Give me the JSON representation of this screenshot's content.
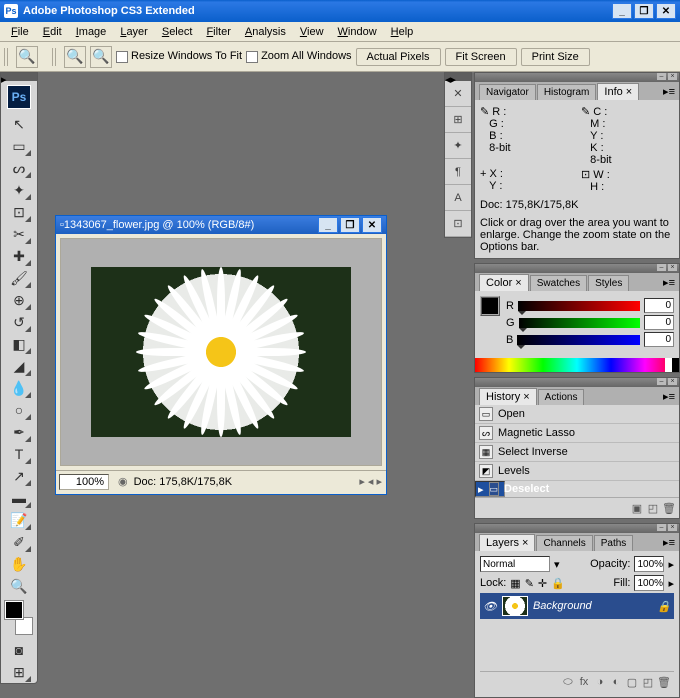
{
  "title": "Adobe Photoshop CS3 Extended",
  "menu": [
    "File",
    "Edit",
    "Image",
    "Layer",
    "Select",
    "Filter",
    "Analysis",
    "View",
    "Window",
    "Help"
  ],
  "options": {
    "resize": "Resize Windows To Fit",
    "zoomall": "Zoom All Windows",
    "actual": "Actual Pixels",
    "fit": "Fit Screen",
    "print": "Print Size"
  },
  "doc": {
    "title": "1343067_flower.jpg @ 100% (RGB/8#)",
    "zoom": "100%",
    "status": "Doc: 175,8K/175,8K"
  },
  "panels": {
    "nav": {
      "tabs": [
        "Navigator",
        "Histogram",
        "Info"
      ]
    },
    "info": {
      "r": "R :",
      "g": "G :",
      "b": "B :",
      "bit1": "8-bit",
      "c": "C :",
      "m": "M :",
      "y": "Y :",
      "k": "K :",
      "bit2": "8-bit",
      "x": "X :",
      "yv": "Y :",
      "w": "W :",
      "h": "H :",
      "doc": "Doc: 175,8K/175,8K",
      "hint": "Click or drag over the area you want to enlarge. Change the zoom state on the Options bar."
    },
    "color": {
      "tabs": [
        "Color",
        "Swatches",
        "Styles"
      ],
      "r": "R",
      "g": "G",
      "b": "B",
      "rv": "0",
      "gv": "0",
      "bv": "0"
    },
    "history": {
      "tabs": [
        "History",
        "Actions"
      ],
      "items": [
        "Open",
        "Magnetic Lasso",
        "Select Inverse",
        "Levels",
        "Deselect"
      ]
    },
    "layers": {
      "tabs": [
        "Layers",
        "Channels",
        "Paths"
      ],
      "mode": "Normal",
      "opacity": "Opacity:",
      "opv": "100%",
      "lock": "Lock:",
      "fill": "Fill:",
      "fv": "100%",
      "bg": "Background"
    }
  }
}
